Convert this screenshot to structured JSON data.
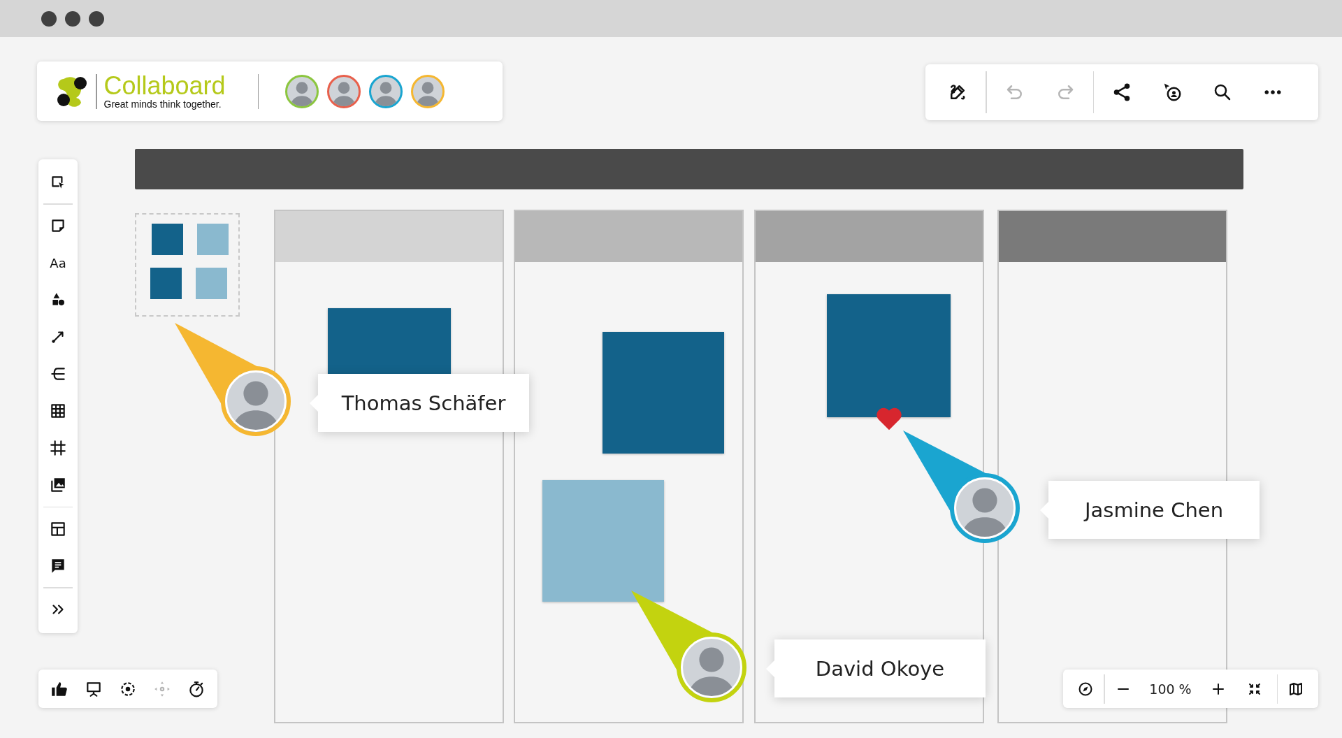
{
  "header": {
    "brand": "Collaboard",
    "tagline": "Great minds think together.",
    "collaborators": [
      {
        "color": "#8cc63f"
      },
      {
        "color": "#e8604c"
      },
      {
        "color": "#1aa5d0"
      },
      {
        "color": "#f5b731"
      }
    ]
  },
  "top_toolbar": {
    "undo_disabled": true,
    "redo_disabled": true
  },
  "left_toolbar": {
    "text_tool_label": "Aa"
  },
  "board": {
    "columns": [
      {
        "color": "#d4d4d4"
      },
      {
        "color": "#b8b8b8"
      },
      {
        "color": "#a3a3a3"
      },
      {
        "color": "#7a7a7a"
      }
    ],
    "template_swatches": [
      {
        "color": "#13628a"
      },
      {
        "color": "#8ab9cf"
      },
      {
        "color": "#13628a"
      },
      {
        "color": "#8ab9cf"
      }
    ],
    "sticky_notes": [
      {
        "color": "#13628a"
      },
      {
        "color": "#13628a"
      },
      {
        "color": "#8ab9cf"
      },
      {
        "color": "#13628a",
        "liked": true
      }
    ],
    "cursors": [
      {
        "name": "Thomas Schäfer",
        "color": "#f5b731"
      },
      {
        "name": "Jasmine Chen",
        "color": "#1aa5d0"
      },
      {
        "name": "David Okoye",
        "color": "#c3d30f"
      }
    ]
  },
  "bottom_toolbar": {
    "center_disabled": true
  },
  "zoom_controls": {
    "zoom": "100 %"
  }
}
